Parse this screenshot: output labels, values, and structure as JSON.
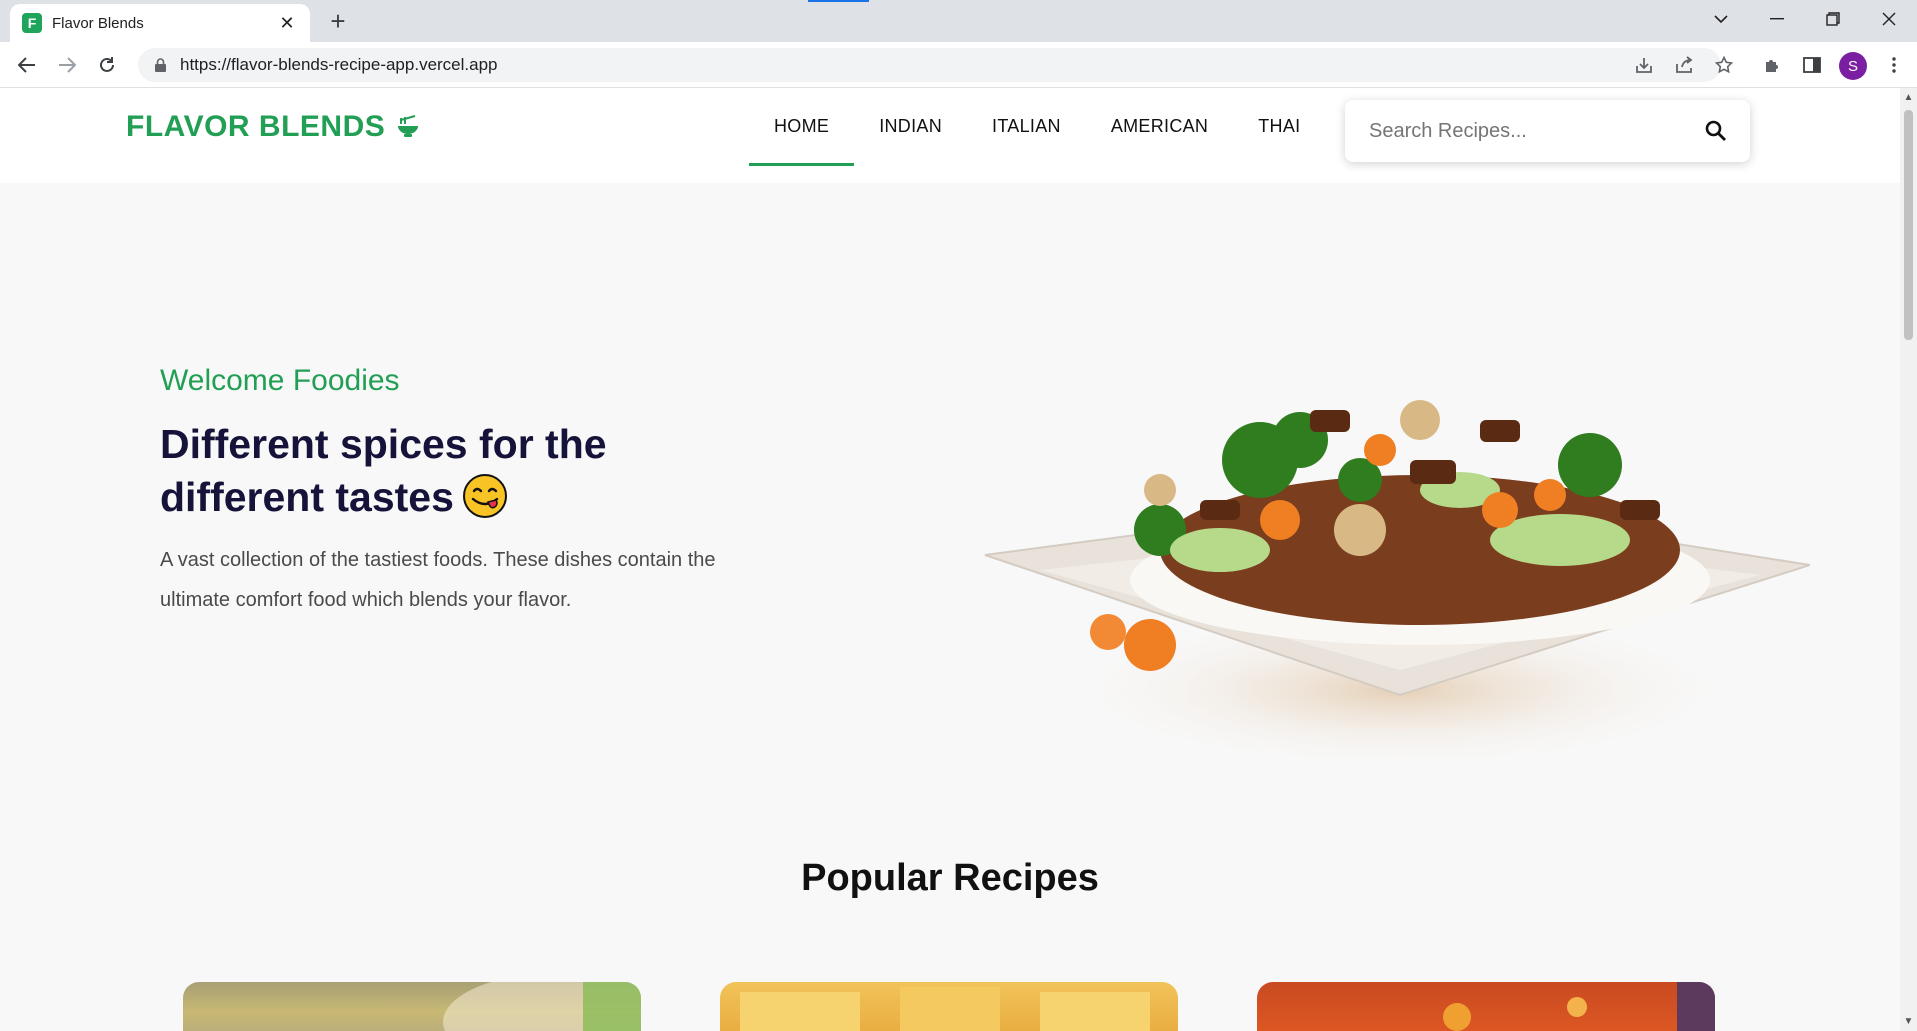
{
  "browser": {
    "tab_title": "Flavor Blends",
    "favicon_letter": "F",
    "url": "https://flavor-blends-recipe-app.vercel.app",
    "profile_initial": "S"
  },
  "site": {
    "logo": "FLAVOR BLENDS",
    "nav": [
      "HOME",
      "INDIAN",
      "ITALIAN",
      "AMERICAN",
      "THAI"
    ],
    "active_nav": "HOME",
    "search_placeholder": "Search Recipes...",
    "hero": {
      "subtitle": "Welcome Foodies",
      "title": "Different spices for the different tastes",
      "description": "A vast collection of the tastiest foods. These dishes contain the ultimate comfort food which blends your flavor."
    },
    "section_title": "Popular Recipes"
  },
  "colors": {
    "brand": "#229f55",
    "heading": "#15133a"
  }
}
